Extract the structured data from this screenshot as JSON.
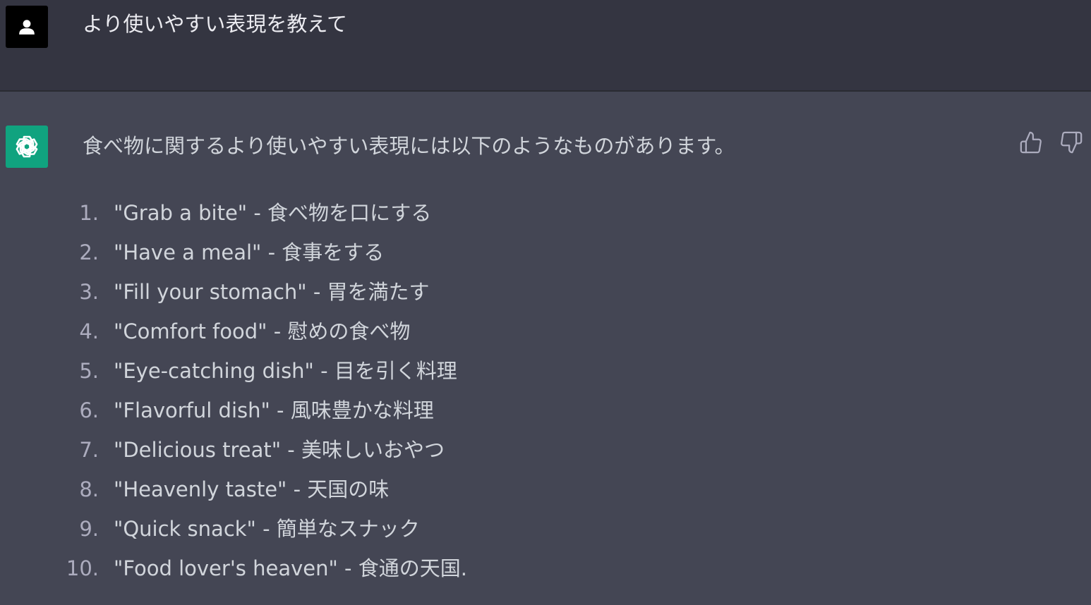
{
  "user": {
    "avatar_icon": "user-silhouette-icon",
    "message": "より使いやすい表現を教えて"
  },
  "assistant": {
    "avatar_icon": "openai-logo-icon",
    "intro": "食べ物に関するより使いやすい表現には以下のようなものがあります。",
    "items": [
      {
        "num": "1.",
        "text": "\"Grab a bite\" - 食べ物を口にする"
      },
      {
        "num": "2.",
        "text": "\"Have a meal\" - 食事をする"
      },
      {
        "num": "3.",
        "text": "\"Fill your stomach\" - 胃を満たす"
      },
      {
        "num": "4.",
        "text": "\"Comfort food\" - 慰めの食べ物"
      },
      {
        "num": "5.",
        "text": "\"Eye-catching dish\" - 目を引く料理"
      },
      {
        "num": "6.",
        "text": "\"Flavorful dish\" - 風味豊かな料理"
      },
      {
        "num": "7.",
        "text": "\"Delicious treat\" - 美味しいおやつ"
      },
      {
        "num": "8.",
        "text": "\"Heavenly taste\" - 天国の味"
      },
      {
        "num": "9.",
        "text": "\"Quick snack\" - 簡単なスナック"
      },
      {
        "num": "10.",
        "text": "\"Food lover's heaven\" - 食通の天国."
      }
    ],
    "feedback": {
      "up_icon": "thumbs-up-icon",
      "down_icon": "thumbs-down-icon"
    }
  },
  "colors": {
    "user_bg": "#343541",
    "assistant_bg": "#444654",
    "assistant_avatar": "#10a37f",
    "text": "#d1d5db"
  }
}
